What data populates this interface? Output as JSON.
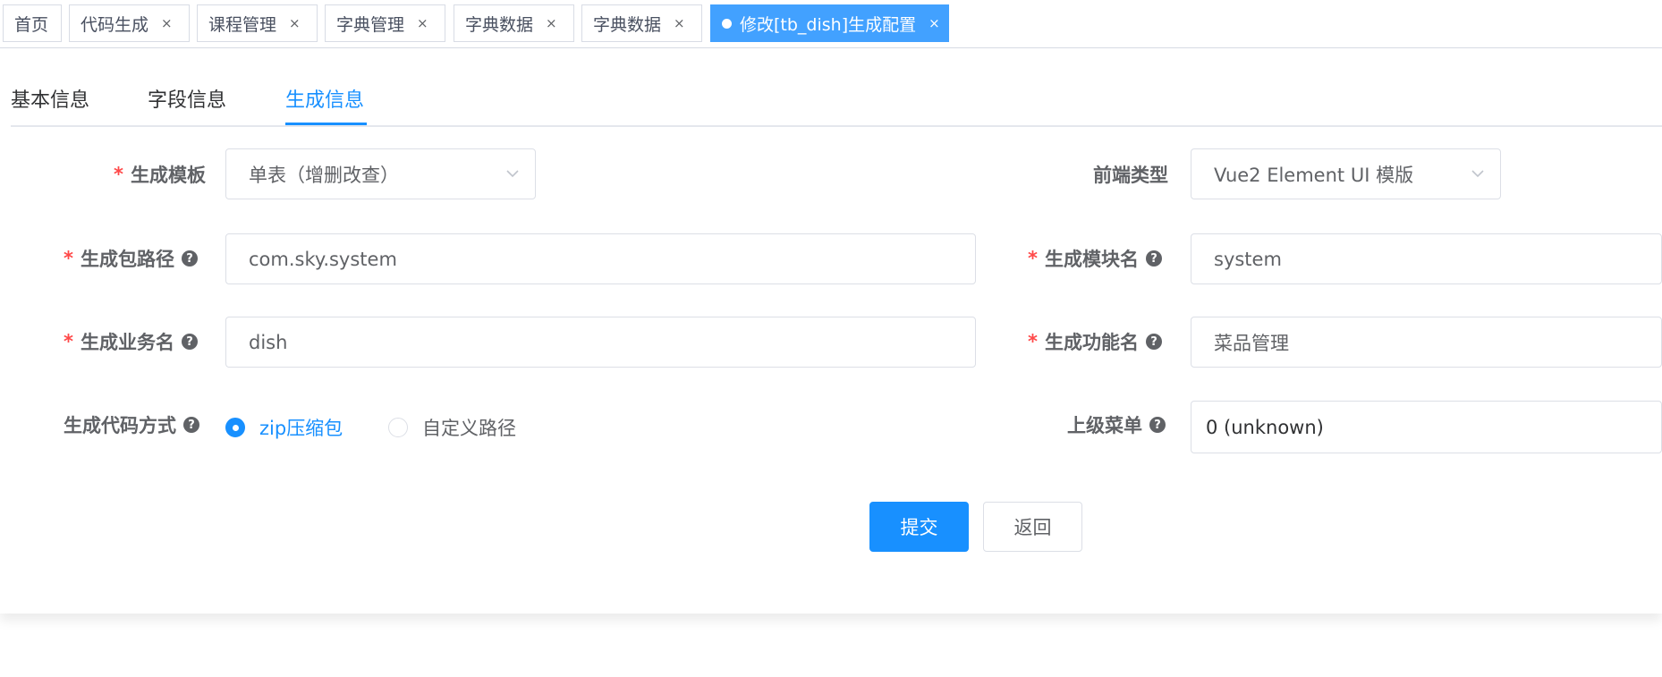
{
  "tags": [
    {
      "label": "首页",
      "closable": false,
      "active": false
    },
    {
      "label": "代码生成",
      "closable": true,
      "active": false
    },
    {
      "label": "课程管理",
      "closable": true,
      "active": false
    },
    {
      "label": "字典管理",
      "closable": true,
      "active": false
    },
    {
      "label": "字典数据",
      "closable": true,
      "active": false
    },
    {
      "label": "字典数据",
      "closable": true,
      "active": false
    },
    {
      "label": "修改[tb_dish]生成配置",
      "closable": true,
      "active": true
    }
  ],
  "tag_close_symbol": "×",
  "tabs": [
    {
      "label": "基本信息",
      "active": false
    },
    {
      "label": "字段信息",
      "active": false
    },
    {
      "label": "生成信息",
      "active": true
    }
  ],
  "form": {
    "tpl_category": {
      "label": "生成模板",
      "required": true,
      "value": "单表（增删改查）"
    },
    "frontend_type": {
      "label": "前端类型",
      "required": false,
      "value": "Vue2 Element UI 模版"
    },
    "package_name": {
      "label": "生成包路径",
      "required": true,
      "value": "com.sky.system"
    },
    "module_name": {
      "label": "生成模块名",
      "required": true,
      "value": "system"
    },
    "business_name": {
      "label": "生成业务名",
      "required": true,
      "value": "dish"
    },
    "function_name": {
      "label": "生成功能名",
      "required": true,
      "value": "菜品管理"
    },
    "gen_type": {
      "label": "生成代码方式",
      "options": [
        {
          "label": "zip压缩包",
          "checked": true
        },
        {
          "label": "自定义路径",
          "checked": false
        }
      ]
    },
    "parent_menu": {
      "label": "上级菜单",
      "value": "0 (unknown)"
    }
  },
  "required_mark": "*",
  "help_symbol": "?",
  "buttons": {
    "submit": "提交",
    "back": "返回"
  },
  "colors": {
    "primary": "#1890ff",
    "active_tag": "#42a1ff",
    "required": "#ff4949"
  }
}
